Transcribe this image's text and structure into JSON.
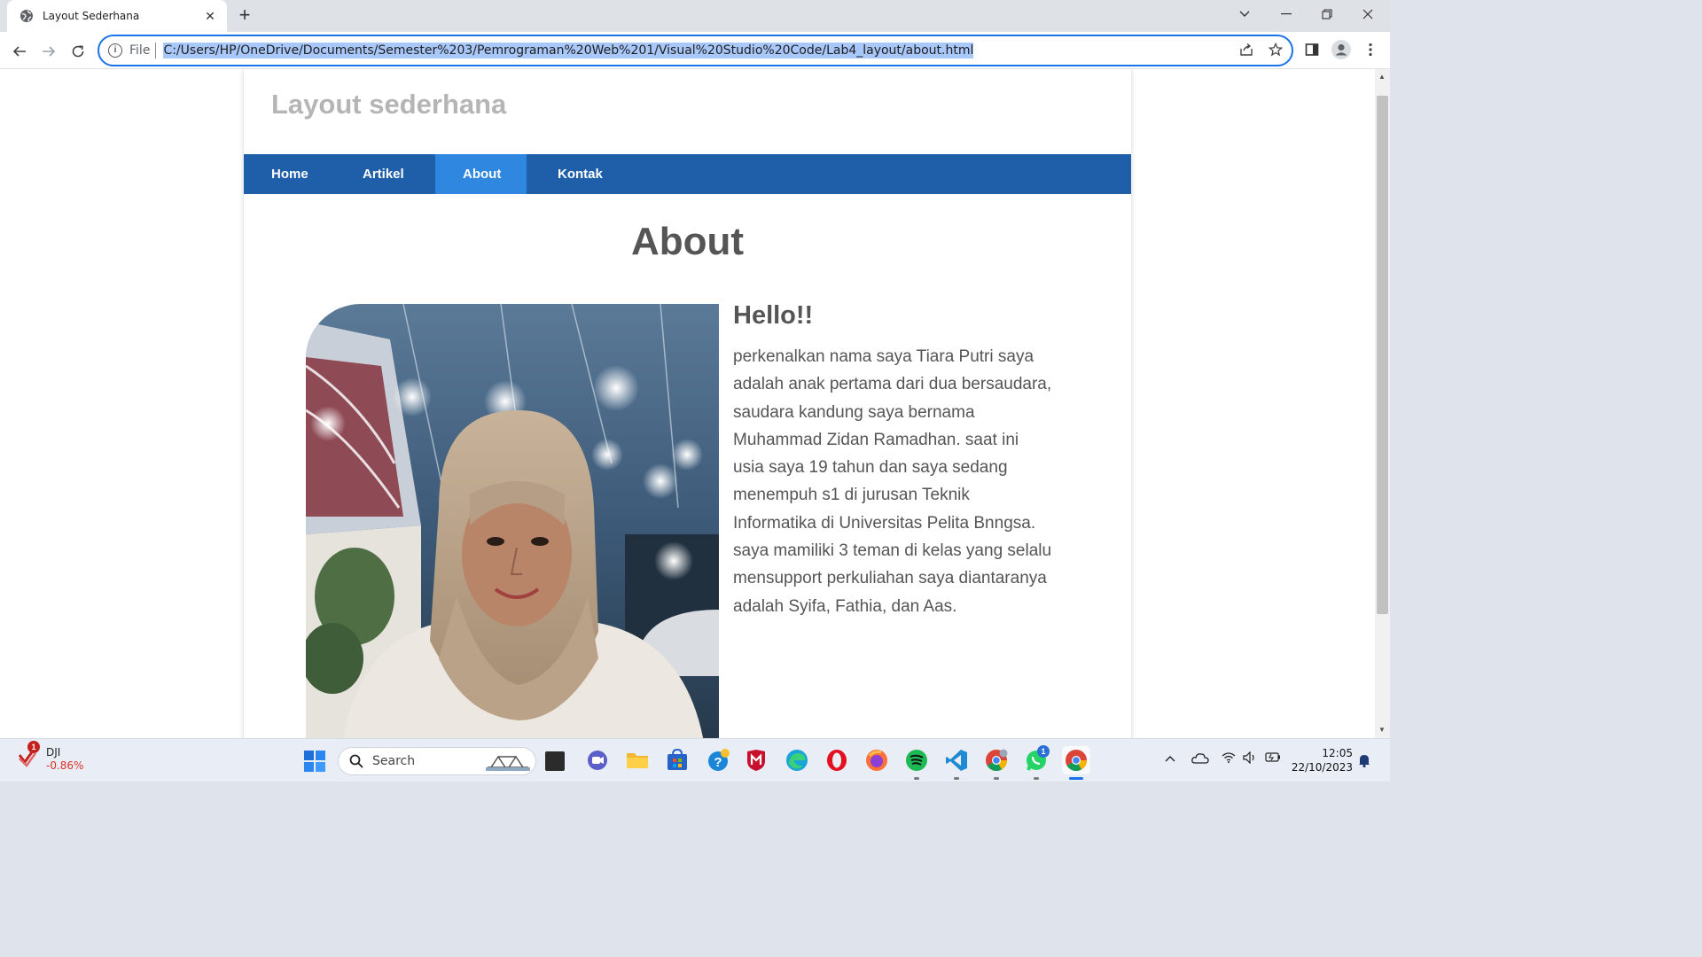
{
  "browser": {
    "tab_title": "Layout Sederhana",
    "scheme_label": "File",
    "url": "C:/Users/HP/OneDrive/Documents/Semester%203/Pemrograman%20Web%201/Visual%20Studio%20Code/Lab4_layout/about.html"
  },
  "site": {
    "header_title": "Layout sederhana",
    "nav": [
      {
        "label": "Home"
      },
      {
        "label": "Artikel"
      },
      {
        "label": "About",
        "active": true
      },
      {
        "label": "Kontak"
      }
    ],
    "page_title": "About",
    "greeting": "Hello!!",
    "bio": "perkenalkan nama saya Tiara Putri saya adalah anak pertama dari dua bersaudara, saudara kandung saya bernama Muhammad Zidan Ramadhan. saat ini usia saya 19 tahun dan saya sedang menempuh s1 di jurusan Teknik Informatika di Universitas Pelita Bnngsa. saya mamiliki 3 teman di kelas yang selalu mensupport perkuliahan saya diantaranya adalah Syifa, Fathia, dan Aas.",
    "photo_icon": "profile-photo"
  },
  "taskbar": {
    "stock_name": "DJI",
    "stock_change": "-0.86%",
    "stock_badge": "1",
    "search_label": "Search",
    "time": "12:05",
    "date": "22/10/2023",
    "whatsapp_badge": "1"
  },
  "colors": {
    "nav_bar": "#1f5faa",
    "nav_active": "#2f87e0",
    "header_text": "#b5b5b5",
    "body_text": "#555555",
    "stock_negative": "#d93025"
  }
}
